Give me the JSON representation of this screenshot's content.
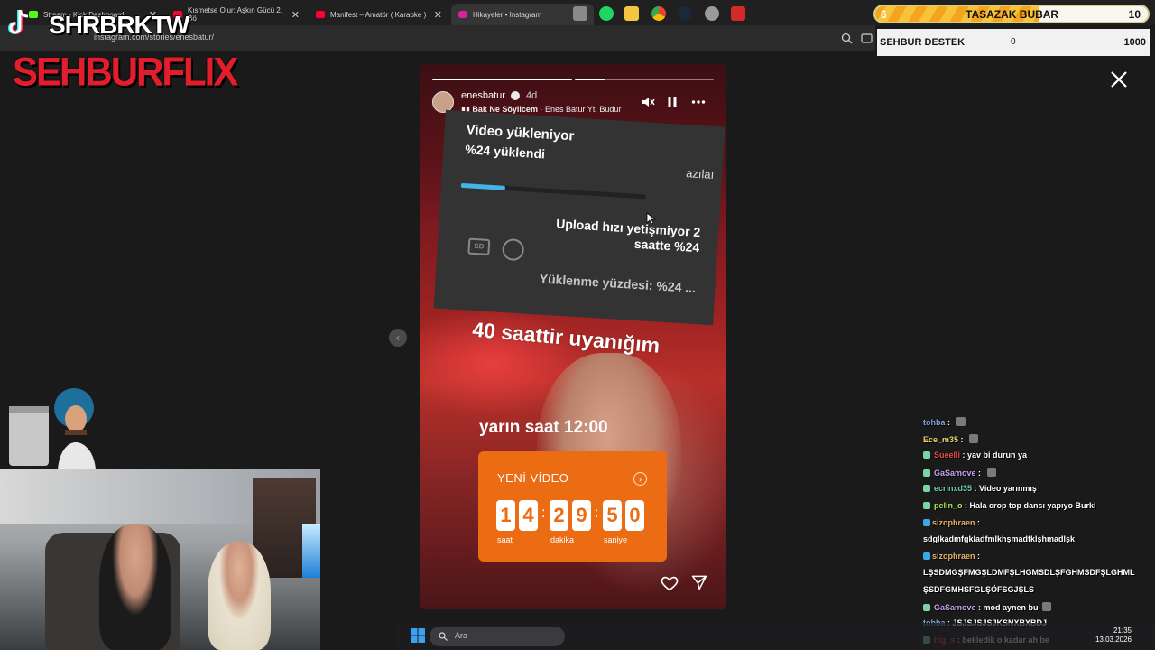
{
  "browser": {
    "tabs": [
      {
        "label": "Stream - Kick Dashboard",
        "fav_color": "#53fc18"
      },
      {
        "label": "Kısmetse Olur: Aşkın Gücü 2. Bö",
        "fav_color": "#ff0033"
      },
      {
        "label": "Manifest – Amatör ( Karaoke )",
        "fav_color": "#ff0033"
      },
      {
        "label": "Hikayeler • Instagram",
        "fav_color": "#d6249f"
      }
    ],
    "url": "instagram.com/stories/enesbatur/"
  },
  "story": {
    "username": "enesbatur",
    "time_ago": "4d",
    "song": "Bak Ne Söylicem",
    "artist": "Enes Batur Yt. Budur",
    "screenshot": {
      "line1": "Video yükleniyor",
      "line2": "%24 yüklendi",
      "side_text": "azılaı",
      "upload_progress": 0.24,
      "upload_msg": "Upload hızı yetişmiyor 2 saatte %24",
      "percent_text": "Yüklenme yüzdesi: %24 ...",
      "sd_label": "SD"
    },
    "caption1": "40 saattir uyanığım",
    "caption2": "yarın saat 12:00",
    "countdown": {
      "title": "YENİ VİDEO",
      "digits": [
        "1",
        "4",
        "2",
        "9",
        "5",
        "0"
      ],
      "labels": [
        "saat",
        "dakika",
        "saniye"
      ]
    }
  },
  "stream": {
    "channel_name": "SHRBRKTW",
    "brand": "SEHBURFLIX",
    "goal": {
      "count": "6",
      "title": "TASAZAK BUBAR",
      "value": "10",
      "progress": 0.6
    },
    "support": {
      "name": "SEHBUR DESTEK",
      "current": "0",
      "max": "1000"
    }
  },
  "chat": [
    {
      "user": "tohba",
      "text": "",
      "color": "#7fa4d6",
      "emote": true,
      "badge": ""
    },
    {
      "user": "Ece_m35",
      "text": "",
      "color": "#e8d66b",
      "emote": true,
      "badge": ""
    },
    {
      "user": "Sueelli",
      "text": "yav bi durun ya",
      "color": "#e64b4b",
      "emote": false,
      "badge": "g"
    },
    {
      "user": "GaSamove",
      "text": "",
      "color": "#c7a3f0",
      "emote": true,
      "badge": "g"
    },
    {
      "user": "ecrinxd35",
      "text": "Video yarınmış",
      "color": "#6fd0a8",
      "emote": false,
      "badge": "g"
    },
    {
      "user": "pelin_o",
      "text": "Hala crop top dansı yapıyo Burki",
      "color": "#a6e65a",
      "emote": false,
      "badge": "g"
    },
    {
      "user": "sizophraen",
      "text": "",
      "color": "#e6b36b",
      "emote": false,
      "badge": "b"
    },
    {
      "user": "",
      "text": "sdglkadmfgkladfmlkhşmadfklşhmadlşk",
      "color": "#ffffff",
      "emote": false,
      "badge": ""
    },
    {
      "user": "sizophraen",
      "text": "",
      "color": "#e6b36b",
      "emote": false,
      "badge": "b"
    },
    {
      "user": "",
      "text": "LŞSDMGŞFMGŞLDMFŞLHGMSDLŞFGHMSDFŞLGHML",
      "color": "#ffffff",
      "emote": false,
      "badge": ""
    },
    {
      "user": "",
      "text": "ŞSDFGMHSFGLŞÖFSGJŞLS",
      "color": "#ffffff",
      "emote": false,
      "badge": ""
    },
    {
      "user": "GaSamove",
      "text": "mod aynen bu",
      "color": "#c7a3f0",
      "emote": true,
      "badge": "g"
    },
    {
      "user": "tohba",
      "text": "JSJSJSJSJKSNXBXBDJ",
      "color": "#7fa4d6",
      "emote": false,
      "badge": ""
    },
    {
      "user": "big_s",
      "text": "bekledik o kadar ah be",
      "color": "#e64b4b",
      "emote": false,
      "badge": "g"
    }
  ],
  "taskbar": {
    "search_placeholder": "Ara",
    "time": "21:35",
    "date": "13.03.2026"
  }
}
